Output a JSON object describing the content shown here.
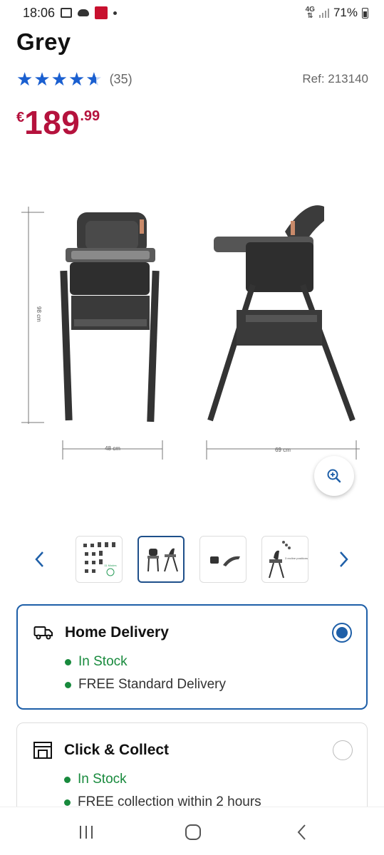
{
  "status_bar": {
    "time": "18:06",
    "network": "4G",
    "battery": "71%"
  },
  "product": {
    "title": "Grey",
    "rating": 4.6,
    "review_count": "(35)",
    "ref": "Ref: 213140",
    "price_currency": "€",
    "price_main": "189",
    "price_cents": ".99",
    "brand_color": "#b5123d",
    "star_color": "#1a5fd0"
  },
  "image": {
    "height_label": "98 cm",
    "width_label": "48 cm",
    "depth_label": "69 cm"
  },
  "thumbnails": {
    "modes_label": "11 Modes",
    "recline_label": "3 recline positions",
    "active_index": 1
  },
  "delivery": {
    "accent_color": "#1e5fa8",
    "stock_color": "#188a3d",
    "home": {
      "title": "Home Delivery",
      "stock": "In Stock",
      "note": "FREE Standard Delivery",
      "selected": true
    },
    "collect": {
      "title": "Click & Collect",
      "stock": "In Stock",
      "note": "FREE collection within 2 hours",
      "selected": false
    }
  }
}
